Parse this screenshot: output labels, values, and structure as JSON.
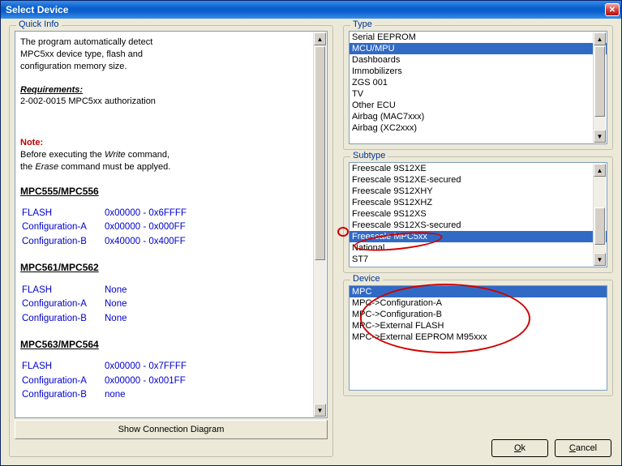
{
  "window": {
    "title": "Select Device"
  },
  "quickinfo": {
    "legend": "Quick Info",
    "intro1": "The program automatically detect",
    "intro2": "MPC5xx device type, flash and",
    "intro3": "configuration memory size.",
    "req_label": "Requirements:",
    "req_text": "2-002-0015  MPC5xx authorization",
    "note_label": "Note:",
    "note_line1_a": "Before executing the ",
    "note_line1_b": "Write",
    "note_line1_c": " command,",
    "note_line2_a": "the ",
    "note_line2_b": "Erase",
    "note_line2_c": " command must be applyed.",
    "sections": [
      {
        "title": "MPC555/MPC556",
        "rows": [
          {
            "name": "FLASH",
            "range": "0x00000 - 0x6FFFF"
          },
          {
            "name": "Configuration-A",
            "range": "0x00000 - 0x000FF"
          },
          {
            "name": "Configuration-B",
            "range": "0x40000 - 0x400FF"
          }
        ]
      },
      {
        "title": "MPC561/MPC562",
        "rows": [
          {
            "name": "FLASH",
            "range": "None"
          },
          {
            "name": "Configuration-A",
            "range": "None"
          },
          {
            "name": "Configuration-B",
            "range": "None"
          }
        ]
      },
      {
        "title": "MPC563/MPC564",
        "rows": [
          {
            "name": "FLASH",
            "range": "0x00000 - 0x7FFFF"
          },
          {
            "name": "Configuration-A",
            "range": "0x00000 - 0x001FF"
          },
          {
            "name": "Configuration-B",
            "range": "none"
          }
        ]
      }
    ],
    "show_button": "Show Connection Diagram"
  },
  "type": {
    "legend": "Type",
    "items": [
      "Serial EEPROM",
      "MCU/MPU",
      "Dashboards",
      "Immobilizers",
      "ZGS 001",
      "TV",
      "Other ECU",
      "Airbag (MAC7xxx)",
      "Airbag (XC2xxx)"
    ],
    "selected": 1
  },
  "subtype": {
    "legend": "Subtype",
    "items": [
      "Freescale 9S12XE",
      "Freescale 9S12XE-secured",
      "Freescale 9S12XHY",
      "Freescale 9S12XHZ",
      "Freescale 9S12XS",
      "Freescale 9S12XS-secured",
      "Freescale MPC5xx",
      "National",
      "ST7"
    ],
    "selected": 6
  },
  "device": {
    "legend": "Device",
    "items": [
      "MPC",
      "MPC->Configuration-A",
      "MPC->Configuration-B",
      "MPC->External FLASH",
      "MPC->External EEPROM M95xxx"
    ],
    "selected": 0
  },
  "buttons": {
    "ok": "Ok",
    "cancel": "Cancel"
  }
}
